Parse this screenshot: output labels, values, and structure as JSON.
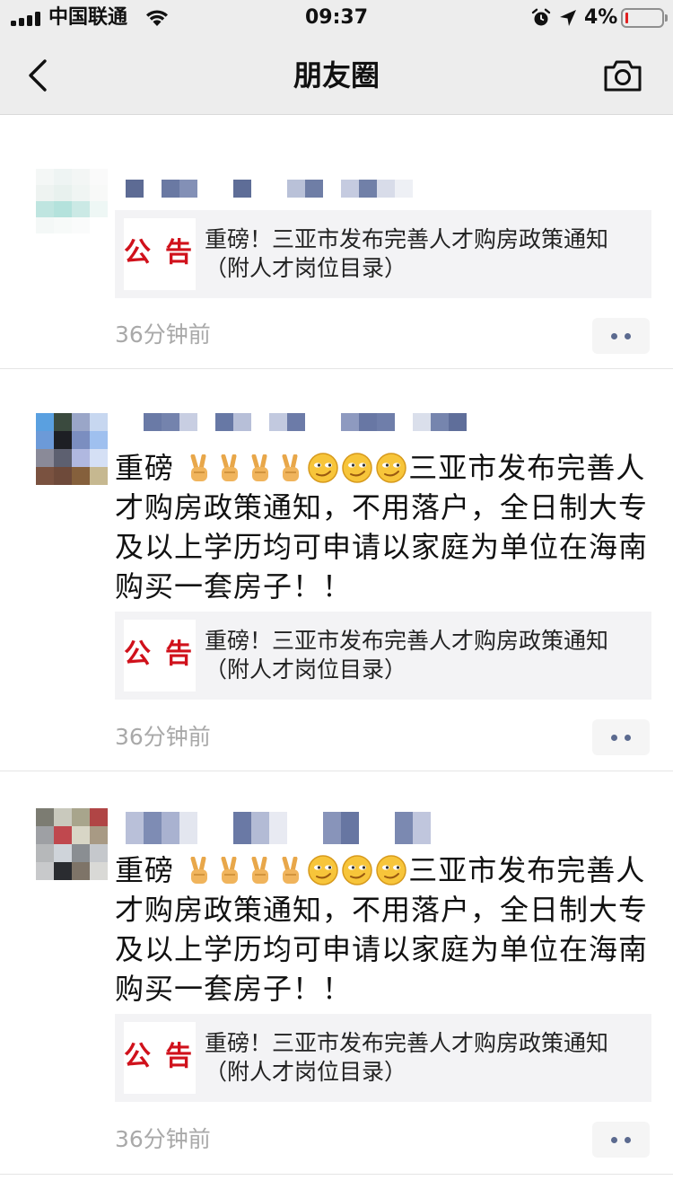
{
  "status_bar": {
    "carrier": "中国联通",
    "time": "09:37",
    "battery_percent": "4%",
    "battery_level": 0.04,
    "icons": [
      "signal-icon",
      "wifi-icon",
      "alarm-icon",
      "location-icon",
      "battery-icon"
    ]
  },
  "nav": {
    "title": "朋友圈",
    "back_icon": "chevron-left-icon",
    "camera_icon": "camera-icon"
  },
  "colors": {
    "background": "#ededed",
    "card_background": "#f3f3f5",
    "time_text": "#a9a9a9",
    "more_dots": "#5b6a8f",
    "notice_red": "#d0111b",
    "battery_low": "#e02020"
  },
  "posts": [
    {
      "text": "",
      "card": {
        "thumb_chars": [
          "公",
          "告"
        ],
        "title": "重磅！三亚市发布完善人才购房政策通知（附人才岗位目录）"
      },
      "time": "36分钟前"
    },
    {
      "text_prefix": "重磅 ",
      "emojis": [
        "✌️",
        "✌️",
        "✌️",
        "✌️",
        "😏",
        "😏",
        "😏"
      ],
      "text": "三亚市发布完善人才购房政策通知，不用落户，全日制大专及以上学历均可申请以家庭为单位在海南购买一套房子！！",
      "card": {
        "thumb_chars": [
          "公",
          "告"
        ],
        "title": "重磅！三亚市发布完善人才购房政策通知（附人才岗位目录）"
      },
      "time": "36分钟前"
    },
    {
      "text_prefix": "重磅 ",
      "emojis": [
        "✌️",
        "✌️",
        "✌️",
        "✌️",
        "😏",
        "😏",
        "😏"
      ],
      "text": "三亚市发布完善人才购房政策通知，不用落户，全日制大专及以上学历均可申请以家庭为单位在海南购买一套房子！！",
      "card": {
        "thumb_chars": [
          "公",
          "告"
        ],
        "title": "重磅！三亚市发布完善人才购房政策通知（附人才岗位目录）"
      },
      "time": "36分钟前"
    }
  ]
}
